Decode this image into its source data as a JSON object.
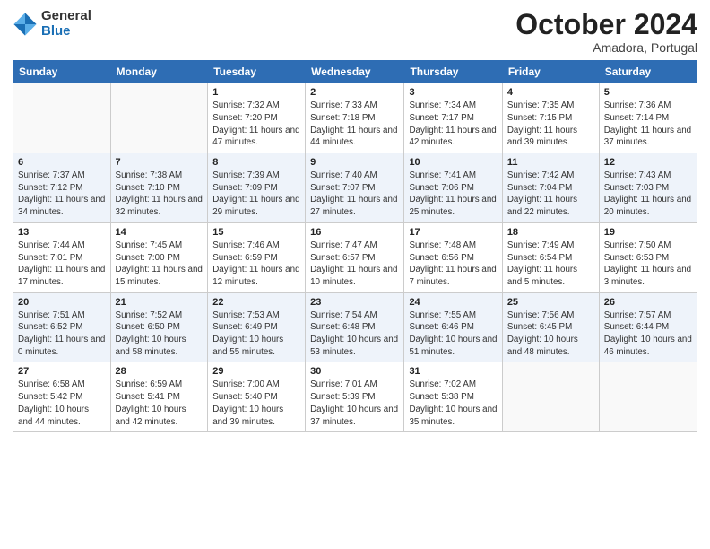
{
  "header": {
    "logo_general": "General",
    "logo_blue": "Blue",
    "month_title": "October 2024",
    "location": "Amadora, Portugal"
  },
  "days_of_week": [
    "Sunday",
    "Monday",
    "Tuesday",
    "Wednesday",
    "Thursday",
    "Friday",
    "Saturday"
  ],
  "weeks": [
    [
      {
        "day": "",
        "sunrise": "",
        "sunset": "",
        "daylight": ""
      },
      {
        "day": "",
        "sunrise": "",
        "sunset": "",
        "daylight": ""
      },
      {
        "day": "1",
        "sunrise": "Sunrise: 7:32 AM",
        "sunset": "Sunset: 7:20 PM",
        "daylight": "Daylight: 11 hours and 47 minutes."
      },
      {
        "day": "2",
        "sunrise": "Sunrise: 7:33 AM",
        "sunset": "Sunset: 7:18 PM",
        "daylight": "Daylight: 11 hours and 44 minutes."
      },
      {
        "day": "3",
        "sunrise": "Sunrise: 7:34 AM",
        "sunset": "Sunset: 7:17 PM",
        "daylight": "Daylight: 11 hours and 42 minutes."
      },
      {
        "day": "4",
        "sunrise": "Sunrise: 7:35 AM",
        "sunset": "Sunset: 7:15 PM",
        "daylight": "Daylight: 11 hours and 39 minutes."
      },
      {
        "day": "5",
        "sunrise": "Sunrise: 7:36 AM",
        "sunset": "Sunset: 7:14 PM",
        "daylight": "Daylight: 11 hours and 37 minutes."
      }
    ],
    [
      {
        "day": "6",
        "sunrise": "Sunrise: 7:37 AM",
        "sunset": "Sunset: 7:12 PM",
        "daylight": "Daylight: 11 hours and 34 minutes."
      },
      {
        "day": "7",
        "sunrise": "Sunrise: 7:38 AM",
        "sunset": "Sunset: 7:10 PM",
        "daylight": "Daylight: 11 hours and 32 minutes."
      },
      {
        "day": "8",
        "sunrise": "Sunrise: 7:39 AM",
        "sunset": "Sunset: 7:09 PM",
        "daylight": "Daylight: 11 hours and 29 minutes."
      },
      {
        "day": "9",
        "sunrise": "Sunrise: 7:40 AM",
        "sunset": "Sunset: 7:07 PM",
        "daylight": "Daylight: 11 hours and 27 minutes."
      },
      {
        "day": "10",
        "sunrise": "Sunrise: 7:41 AM",
        "sunset": "Sunset: 7:06 PM",
        "daylight": "Daylight: 11 hours and 25 minutes."
      },
      {
        "day": "11",
        "sunrise": "Sunrise: 7:42 AM",
        "sunset": "Sunset: 7:04 PM",
        "daylight": "Daylight: 11 hours and 22 minutes."
      },
      {
        "day": "12",
        "sunrise": "Sunrise: 7:43 AM",
        "sunset": "Sunset: 7:03 PM",
        "daylight": "Daylight: 11 hours and 20 minutes."
      }
    ],
    [
      {
        "day": "13",
        "sunrise": "Sunrise: 7:44 AM",
        "sunset": "Sunset: 7:01 PM",
        "daylight": "Daylight: 11 hours and 17 minutes."
      },
      {
        "day": "14",
        "sunrise": "Sunrise: 7:45 AM",
        "sunset": "Sunset: 7:00 PM",
        "daylight": "Daylight: 11 hours and 15 minutes."
      },
      {
        "day": "15",
        "sunrise": "Sunrise: 7:46 AM",
        "sunset": "Sunset: 6:59 PM",
        "daylight": "Daylight: 11 hours and 12 minutes."
      },
      {
        "day": "16",
        "sunrise": "Sunrise: 7:47 AM",
        "sunset": "Sunset: 6:57 PM",
        "daylight": "Daylight: 11 hours and 10 minutes."
      },
      {
        "day": "17",
        "sunrise": "Sunrise: 7:48 AM",
        "sunset": "Sunset: 6:56 PM",
        "daylight": "Daylight: 11 hours and 7 minutes."
      },
      {
        "day": "18",
        "sunrise": "Sunrise: 7:49 AM",
        "sunset": "Sunset: 6:54 PM",
        "daylight": "Daylight: 11 hours and 5 minutes."
      },
      {
        "day": "19",
        "sunrise": "Sunrise: 7:50 AM",
        "sunset": "Sunset: 6:53 PM",
        "daylight": "Daylight: 11 hours and 3 minutes."
      }
    ],
    [
      {
        "day": "20",
        "sunrise": "Sunrise: 7:51 AM",
        "sunset": "Sunset: 6:52 PM",
        "daylight": "Daylight: 11 hours and 0 minutes."
      },
      {
        "day": "21",
        "sunrise": "Sunrise: 7:52 AM",
        "sunset": "Sunset: 6:50 PM",
        "daylight": "Daylight: 10 hours and 58 minutes."
      },
      {
        "day": "22",
        "sunrise": "Sunrise: 7:53 AM",
        "sunset": "Sunset: 6:49 PM",
        "daylight": "Daylight: 10 hours and 55 minutes."
      },
      {
        "day": "23",
        "sunrise": "Sunrise: 7:54 AM",
        "sunset": "Sunset: 6:48 PM",
        "daylight": "Daylight: 10 hours and 53 minutes."
      },
      {
        "day": "24",
        "sunrise": "Sunrise: 7:55 AM",
        "sunset": "Sunset: 6:46 PM",
        "daylight": "Daylight: 10 hours and 51 minutes."
      },
      {
        "day": "25",
        "sunrise": "Sunrise: 7:56 AM",
        "sunset": "Sunset: 6:45 PM",
        "daylight": "Daylight: 10 hours and 48 minutes."
      },
      {
        "day": "26",
        "sunrise": "Sunrise: 7:57 AM",
        "sunset": "Sunset: 6:44 PM",
        "daylight": "Daylight: 10 hours and 46 minutes."
      }
    ],
    [
      {
        "day": "27",
        "sunrise": "Sunrise: 6:58 AM",
        "sunset": "Sunset: 5:42 PM",
        "daylight": "Daylight: 10 hours and 44 minutes."
      },
      {
        "day": "28",
        "sunrise": "Sunrise: 6:59 AM",
        "sunset": "Sunset: 5:41 PM",
        "daylight": "Daylight: 10 hours and 42 minutes."
      },
      {
        "day": "29",
        "sunrise": "Sunrise: 7:00 AM",
        "sunset": "Sunset: 5:40 PM",
        "daylight": "Daylight: 10 hours and 39 minutes."
      },
      {
        "day": "30",
        "sunrise": "Sunrise: 7:01 AM",
        "sunset": "Sunset: 5:39 PM",
        "daylight": "Daylight: 10 hours and 37 minutes."
      },
      {
        "day": "31",
        "sunrise": "Sunrise: 7:02 AM",
        "sunset": "Sunset: 5:38 PM",
        "daylight": "Daylight: 10 hours and 35 minutes."
      },
      {
        "day": "",
        "sunrise": "",
        "sunset": "",
        "daylight": ""
      },
      {
        "day": "",
        "sunrise": "",
        "sunset": "",
        "daylight": ""
      }
    ]
  ]
}
